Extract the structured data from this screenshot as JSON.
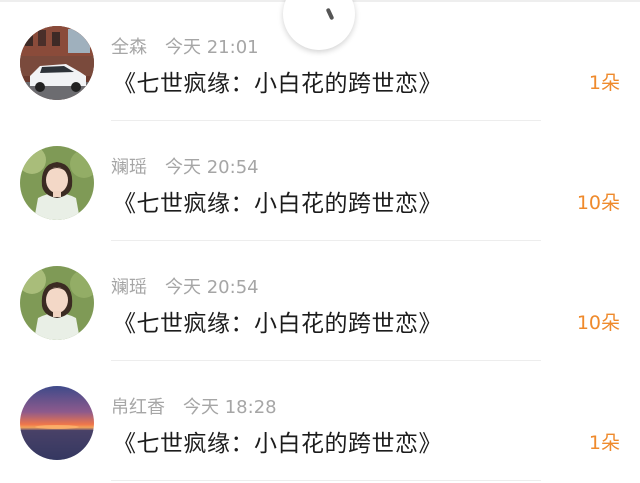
{
  "items": [
    {
      "name": "全森",
      "time": "今天 21:01",
      "title": "《七世疯缘：小白花的跨世恋》",
      "amount": "1朵",
      "avatar": "car-photo"
    },
    {
      "name": "斓瑶",
      "time": "今天 20:54",
      "title": "《七世疯缘：小白花的跨世恋》",
      "amount": "10朵",
      "avatar": "girl-photo"
    },
    {
      "name": "斓瑶",
      "time": "今天 20:54",
      "title": "《七世疯缘：小白花的跨世恋》",
      "amount": "10朵",
      "avatar": "girl-photo"
    },
    {
      "name": "帛红香",
      "time": "今天 18:28",
      "title": "《七世疯缘：小白花的跨世恋》",
      "amount": "1朵",
      "avatar": "sunset-photo"
    }
  ],
  "colors": {
    "amount": "#ef8a2c",
    "meta": "#a6a6a6",
    "title": "#1c1c1c",
    "divider": "#ededed"
  },
  "overlay": {
    "icon": "loading-spinner-icon"
  }
}
